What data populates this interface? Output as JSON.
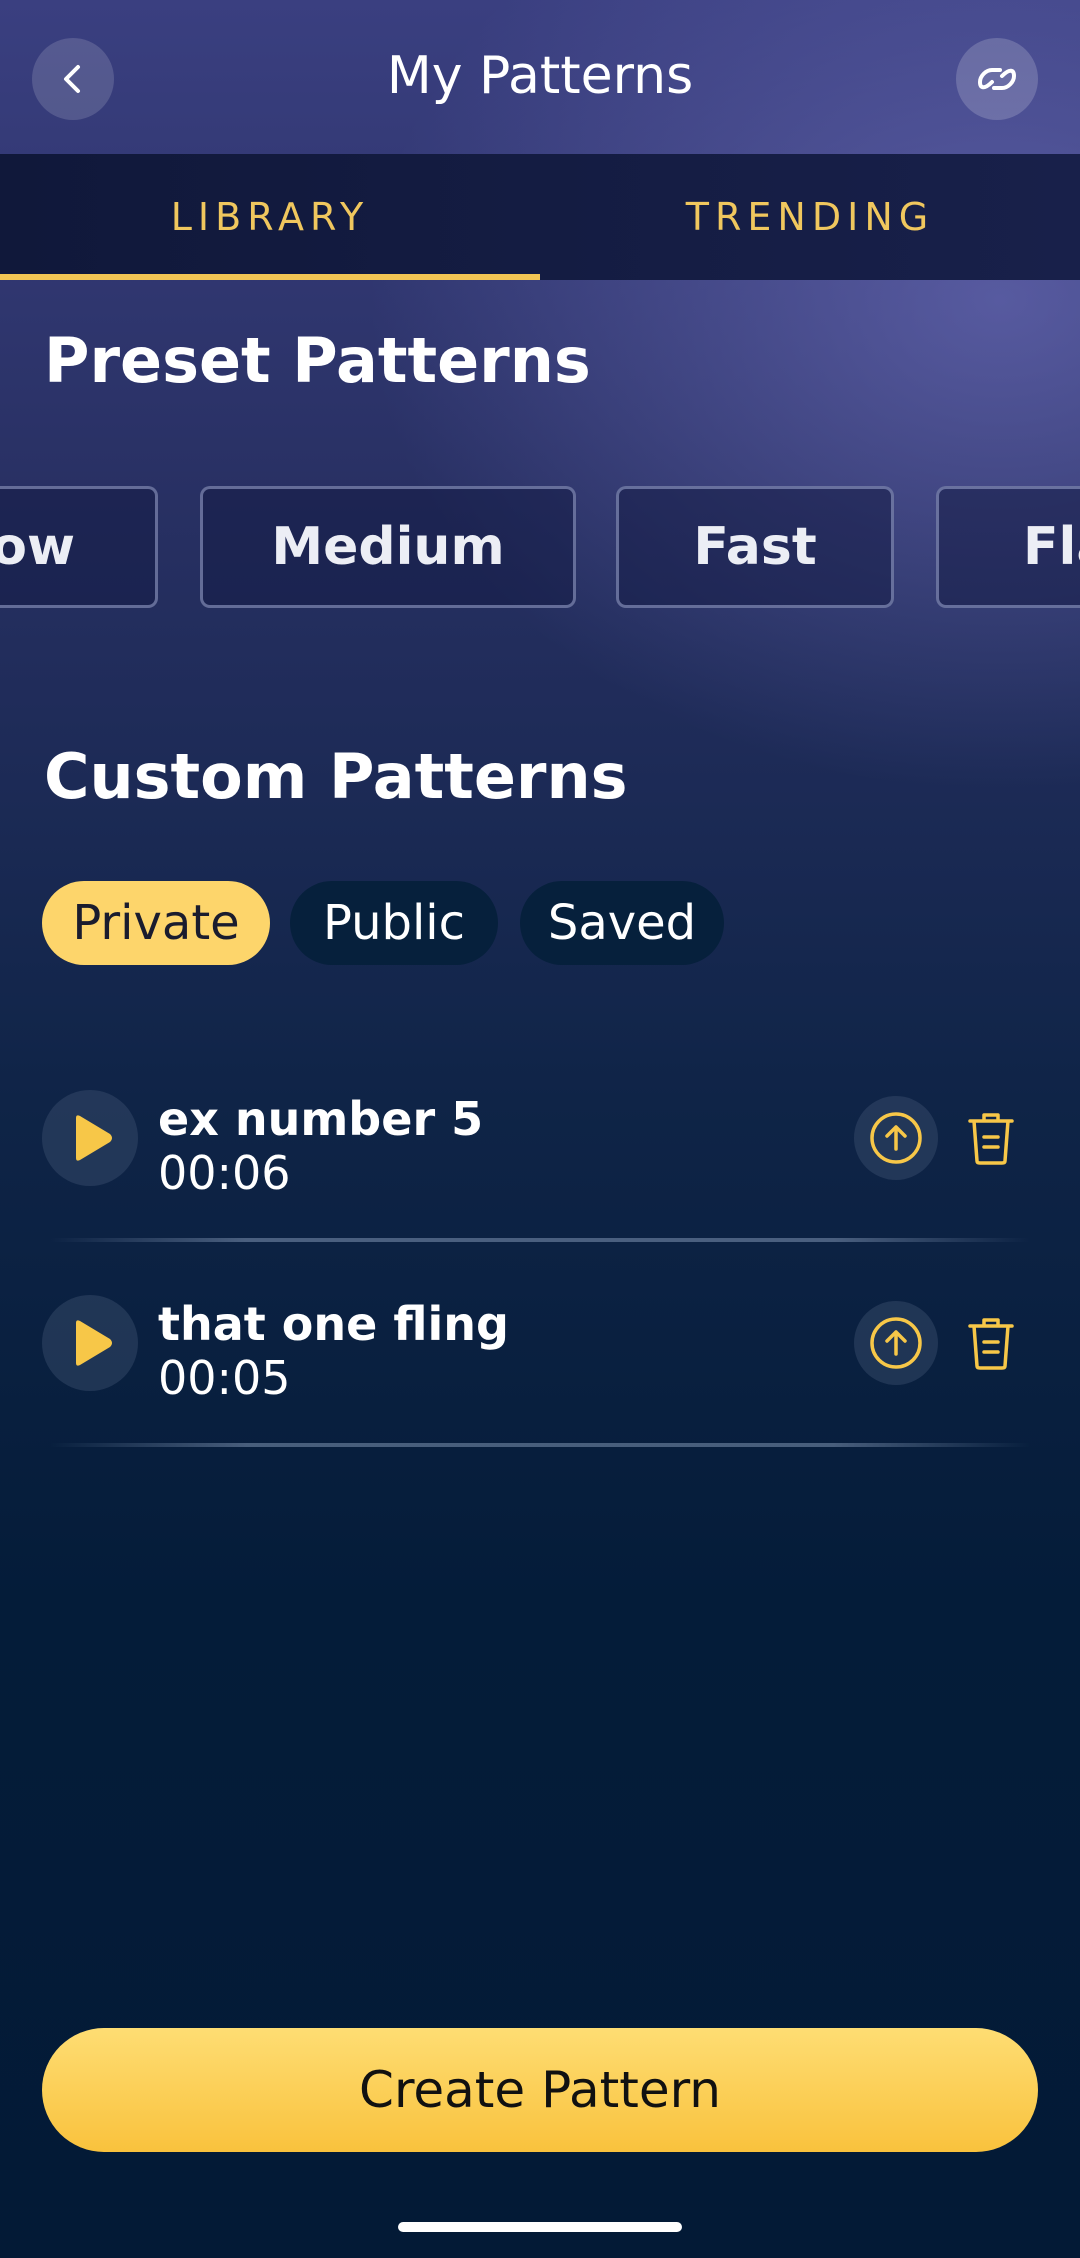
{
  "header": {
    "title": "My Patterns",
    "back_icon": "chevron-left-icon",
    "link_icon": "link-icon"
  },
  "tabs": [
    {
      "label": "LIBRARY",
      "active": true
    },
    {
      "label": "TRENDING",
      "active": false
    }
  ],
  "preset_section": {
    "title": "Preset Patterns",
    "items": [
      "Slow",
      "Medium",
      "Fast",
      "Flash"
    ]
  },
  "custom_section": {
    "title": "Custom Patterns",
    "filters": [
      {
        "label": "Private",
        "active": true
      },
      {
        "label": "Public",
        "active": false
      },
      {
        "label": "Saved",
        "active": false
      }
    ]
  },
  "patterns": [
    {
      "name": "ex number 5",
      "duration": "00:06"
    },
    {
      "name": "that one fling",
      "duration": "00:05"
    }
  ],
  "actions": {
    "create_label": "Create Pattern"
  },
  "colors": {
    "accent": "#F2C554",
    "background_top": "#3A3F80",
    "background_bottom": "#031A36"
  }
}
